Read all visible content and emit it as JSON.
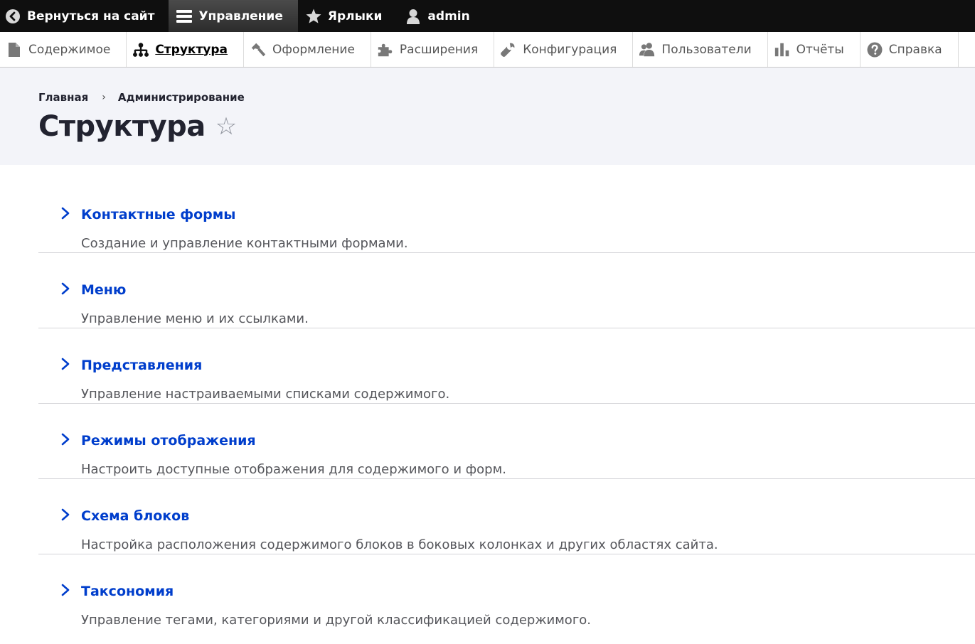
{
  "toolbar": {
    "back_label": "Вернуться на сайт",
    "manage_label": "Управление",
    "shortcuts_label": "Ярлыки",
    "user_label": "admin"
  },
  "tray": {
    "items": [
      {
        "label": "Содержимое",
        "icon": "document-icon"
      },
      {
        "label": "Структура",
        "icon": "sitemap-icon",
        "active": true
      },
      {
        "label": "Оформление",
        "icon": "paintbrush-icon"
      },
      {
        "label": "Расширения",
        "icon": "puzzle-icon"
      },
      {
        "label": "Конфигурация",
        "icon": "wrench-icon"
      },
      {
        "label": "Пользователи",
        "icon": "people-icon"
      },
      {
        "label": "Отчёты",
        "icon": "bar-chart-icon"
      },
      {
        "label": "Справка",
        "icon": "question-icon"
      }
    ]
  },
  "breadcrumb": {
    "home": "Главная",
    "separator": "›",
    "admin": "Администрирование"
  },
  "page": {
    "title": "Структура",
    "star": "☆"
  },
  "list": {
    "items": [
      {
        "title": "Контактные формы",
        "description": "Создание и управление контактными формами."
      },
      {
        "title": "Меню",
        "description": "Управление меню и их ссылками."
      },
      {
        "title": "Представления",
        "description": "Управление настраиваемыми списками содержимого."
      },
      {
        "title": "Режимы отображения",
        "description": "Настроить доступные отображения для содержимого и форм."
      },
      {
        "title": "Схема блоков",
        "description": "Настройка расположения содержимого блоков в боковых колонках и других областях сайта."
      },
      {
        "title": "Таксономия",
        "description": "Управление тегами, категориями и другой классификацией содержимого."
      }
    ]
  },
  "colors": {
    "toolbar_bg": "#0f0f0f",
    "header_bg": "#f3f4f9",
    "link": "#003ecc",
    "text": "#222330",
    "muted": "#55565b"
  }
}
